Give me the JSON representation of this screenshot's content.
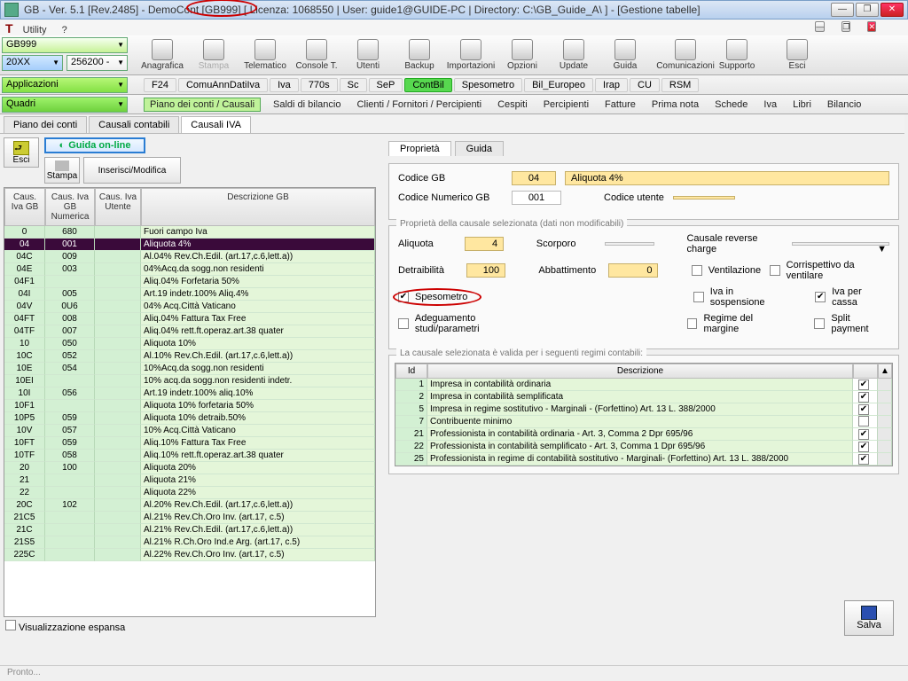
{
  "window": {
    "title": "GB - Ver. 5.1 [Rev.2485] -  DemoCont [GB999]     [ Licenza: 1068550 | User: guide1@GUIDE-PC | Directory: C:\\GB_Guide_A\\ ] - [Gestione tabelle]"
  },
  "menubar": {
    "utility": "Utility",
    "help": "?"
  },
  "combos": {
    "ditta": "GB999",
    "anno": "20XX",
    "codice": "256200 -",
    "applicazioni": "Applicazioni",
    "quadri": "Quadri"
  },
  "toolbar": [
    "Anagrafica",
    "Stampa",
    "Telematico",
    "Console T.",
    "Utenti",
    "Backup",
    "Importazioni",
    "Opzioni",
    "Update",
    "Guida",
    "",
    "Comunicazioni",
    "Supporto",
    "",
    "Esci"
  ],
  "toolbar_disabled": [
    1
  ],
  "strip": [
    "F24",
    "ComuAnnDatiIva",
    "Iva",
    "770s",
    "Sc",
    "SeP",
    "ContBil",
    "Spesometro",
    "Bil_Europeo",
    "Irap",
    "CU",
    "RSM"
  ],
  "strip_active": 6,
  "subtabs": [
    "Piano dei conti / Causali",
    "Saldi di bilancio",
    "Clienti / Fornitori / Percipienti",
    "Cespiti",
    "Percipienti",
    "Fatture",
    "Prima nota",
    "Schede",
    "Iva",
    "Libri",
    "Bilancio"
  ],
  "page_tabs": [
    "Piano dei conti",
    "Causali contabili",
    "Causali IVA"
  ],
  "page_tab_active": 2,
  "left": {
    "esci": "Esci",
    "guida": "Guida on-line",
    "stampa": "Stampa",
    "inserisci": "Inserisci/Modifica",
    "headers": [
      "Caus. Iva GB",
      "Caus. Iva GB Numerica",
      "Caus. Iva Utente",
      "Descrizione GB"
    ],
    "rows": [
      [
        "0",
        "680",
        "",
        "Fuori campo Iva"
      ],
      [
        "04",
        "001",
        "",
        "Aliquota 4%"
      ],
      [
        "04C",
        "009",
        "",
        "Al.04% Rev.Ch.Edil. (art.17,c.6,lett.a))"
      ],
      [
        "04E",
        "003",
        "",
        "04%Acq.da sogg.non residenti"
      ],
      [
        "04F1",
        "",
        "",
        "Aliq.04% Forfetaria 50%"
      ],
      [
        "04I",
        "005",
        "",
        "Art.19 indetr.100% Aliq.4%"
      ],
      [
        "04V",
        "0U6",
        "",
        "04% Acq.Città Vaticano"
      ],
      [
        "04FT",
        "008",
        "",
        "Aliq.04% Fattura Tax Free"
      ],
      [
        "04TF",
        "007",
        "",
        "Aliq.04% rett.ft.operaz.art.38 quater"
      ],
      [
        "10",
        "050",
        "",
        "Aliquota 10%"
      ],
      [
        "10C",
        "052",
        "",
        "Al.10% Rev.Ch.Edil. (art.17,c.6,lett.a))"
      ],
      [
        "10E",
        "054",
        "",
        "10%Acq.da sogg.non residenti"
      ],
      [
        "10EI",
        "",
        "",
        "10% acq.da sogg.non residenti indetr."
      ],
      [
        "10I",
        "056",
        "",
        "Art.19 indetr.100% aliq.10%"
      ],
      [
        "10F1",
        "",
        "",
        "Aliquota 10% forfetaria 50%"
      ],
      [
        "10P5",
        "059",
        "",
        "Aliquota 10% detraib.50%"
      ],
      [
        "10V",
        "057",
        "",
        "10% Acq.Città Vaticano"
      ],
      [
        "10FT",
        "059",
        "",
        "Aliq.10% Fattura Tax Free"
      ],
      [
        "10TF",
        "058",
        "",
        "Aliq.10% rett.ft.operaz.art.38 quater"
      ],
      [
        "20",
        "100",
        "",
        "Aliquota 20%"
      ],
      [
        "21",
        "",
        "",
        "Aliquota 21%"
      ],
      [
        "22",
        "",
        "",
        "Aliquota 22%"
      ],
      [
        "20C",
        "102",
        "",
        "Al.20% Rev.Ch.Edil. (art.17,c.6,lett.a))"
      ],
      [
        "21C5",
        "",
        "",
        "Al.21% Rev.Ch.Oro Inv. (art.17, c.5)"
      ],
      [
        "21C",
        "",
        "",
        "Al.21% Rev.Ch.Edil. (art.17,c.6,lett.a))"
      ],
      [
        "21S5",
        "",
        "",
        "Al.21% R.Ch.Oro Ind.e Arg. (art.17, c.5)"
      ],
      [
        "225C",
        "",
        "",
        "Al.22% Rev.Ch.Oro Inv. (art.17, c.5)"
      ]
    ],
    "selected_row": 1,
    "visespansa": "Visualizzazione espansa"
  },
  "right": {
    "tabs": [
      "Proprietà",
      "Guida"
    ],
    "codice_gb_lbl": "Codice GB",
    "codice_gb": "04",
    "codice_desc": "Aliquota 4%",
    "codice_num_lbl": "Codice Numerico GB",
    "codice_num": "001",
    "codice_utente_lbl": "Codice utente",
    "codice_utente": "",
    "group1": "Proprietà della causale selezionata (dati non modificabili)",
    "aliquota_lbl": "Aliquota",
    "aliquota": "4",
    "scorporo_lbl": "Scorporo",
    "scorporo": "",
    "reverse_lbl": "Causale reverse charge",
    "reverse": "",
    "detraib_lbl": "Detraibilità",
    "detraib": "100",
    "abbatt_lbl": "Abbattimento",
    "abbatt": "0",
    "chk_spesometro": "Spesometro",
    "chk_adeg": "Adeguamento studi/parametri",
    "chk_vent": "Ventilazione",
    "chk_corr": "Corrispettivo da ventilare",
    "chk_ivasos": "Iva in sospensione",
    "chk_ivacas": "Iva per cassa",
    "chk_regm": "Regime del margine",
    "chk_split": "Split payment",
    "group2": "La causale selezionata è valida per i seguenti regimi contabili:",
    "rhead": [
      "Id",
      "Descrizione"
    ],
    "rrows": [
      [
        "1",
        "Impresa  in contabilità ordinaria",
        true
      ],
      [
        "2",
        "Impresa  in contabilità semplificata",
        true
      ],
      [
        "5",
        "Impresa in regime sostitutivo - Marginali - (Forfettino) Art. 13 L. 388/2000",
        true
      ],
      [
        "7",
        "Contribuente minimo",
        false
      ],
      [
        "21",
        "Professionista in contabilità ordinaria - Art. 3, Comma 2 Dpr 695/96",
        true
      ],
      [
        "22",
        "Professionista in contabilità semplificato - Art. 3, Comma 1 Dpr 695/96",
        true
      ],
      [
        "25",
        "Professionista in regime di contabilità sostitutivo - Marginali- (Forfettino) Art. 13 L. 388/2000",
        true
      ]
    ],
    "salva": "Salva"
  },
  "status": "Pronto..."
}
